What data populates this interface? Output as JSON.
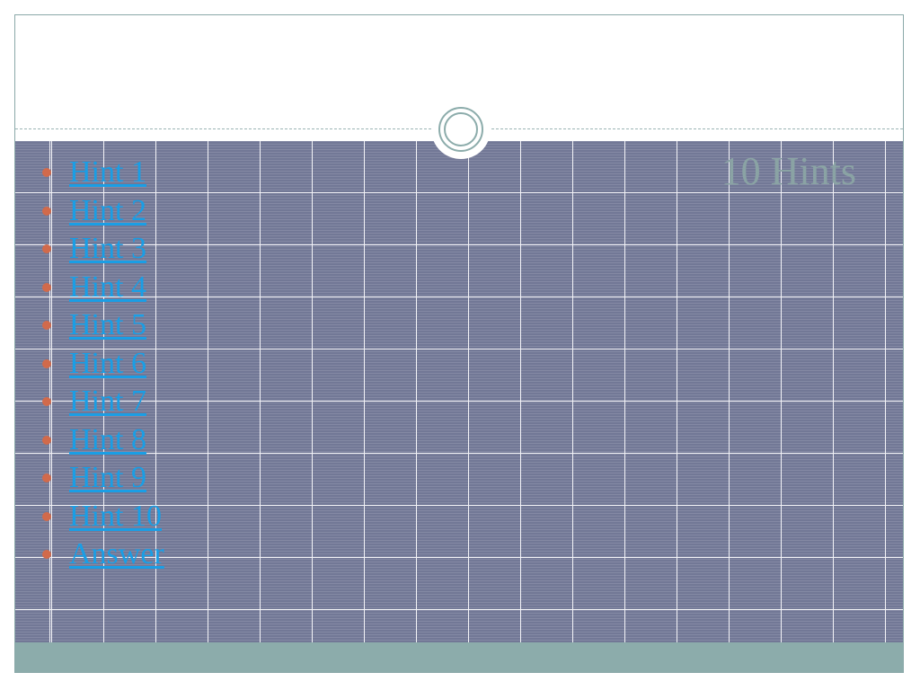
{
  "slide": {
    "title": "10 Hints",
    "hints": [
      {
        "label": "Hint 1"
      },
      {
        "label": "Hint 2"
      },
      {
        "label": "Hint 3"
      },
      {
        "label": "Hint 4"
      },
      {
        "label": "Hint 5"
      },
      {
        "label": "Hint 6"
      },
      {
        "label": "Hint 7"
      },
      {
        "label": "Hint 8"
      },
      {
        "label": " Hint 9"
      },
      {
        "label": "Hint 10"
      },
      {
        "label": "Answer"
      }
    ]
  },
  "colors": {
    "link": "#1a9ee5",
    "bullet": "#d16a4b",
    "title": "#8aa3a4",
    "body_background": "#727896",
    "footer_band": "#8cacab"
  }
}
